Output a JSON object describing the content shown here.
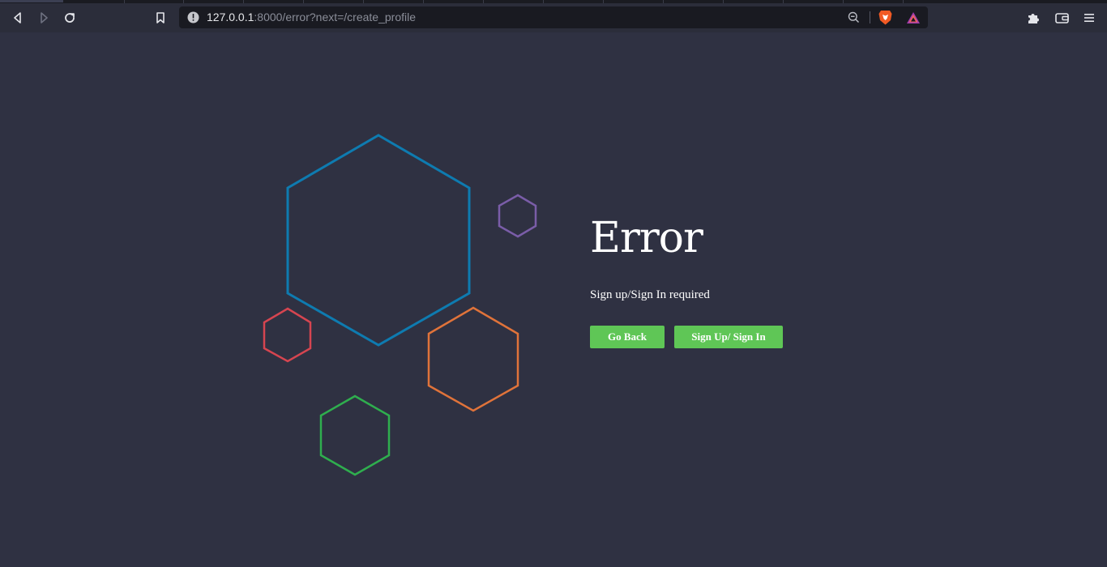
{
  "browser": {
    "url_host": "127.0.0.1",
    "url_rest": ":8000/error?next=/create_profile",
    "icons": {
      "back": "back-arrow-icon",
      "forward": "forward-arrow-icon",
      "reload": "reload-icon",
      "bookmark": "bookmark-icon",
      "site_info": "warning-info-icon",
      "zoom": "zoom-icon",
      "brave_shield": "brave-shield-icon",
      "rewards": "brave-rewards-icon",
      "extensions": "puzzle-extensions-icon",
      "wallet": "wallet-icon",
      "menu": "hamburger-menu-icon"
    }
  },
  "page": {
    "title": "Error",
    "message": "Sign up/Sign In required",
    "buttons": {
      "back_label": "Go Back",
      "sign_label": "Sign Up/ Sign In"
    },
    "colors": {
      "background": "#2f3142",
      "button": "#5fc656",
      "hex_blue": "#0e7bb0",
      "hex_purple": "#7a5da8",
      "hex_red": "#d64550",
      "hex_orange": "#e0733a",
      "hex_green": "#2fae4e"
    }
  }
}
